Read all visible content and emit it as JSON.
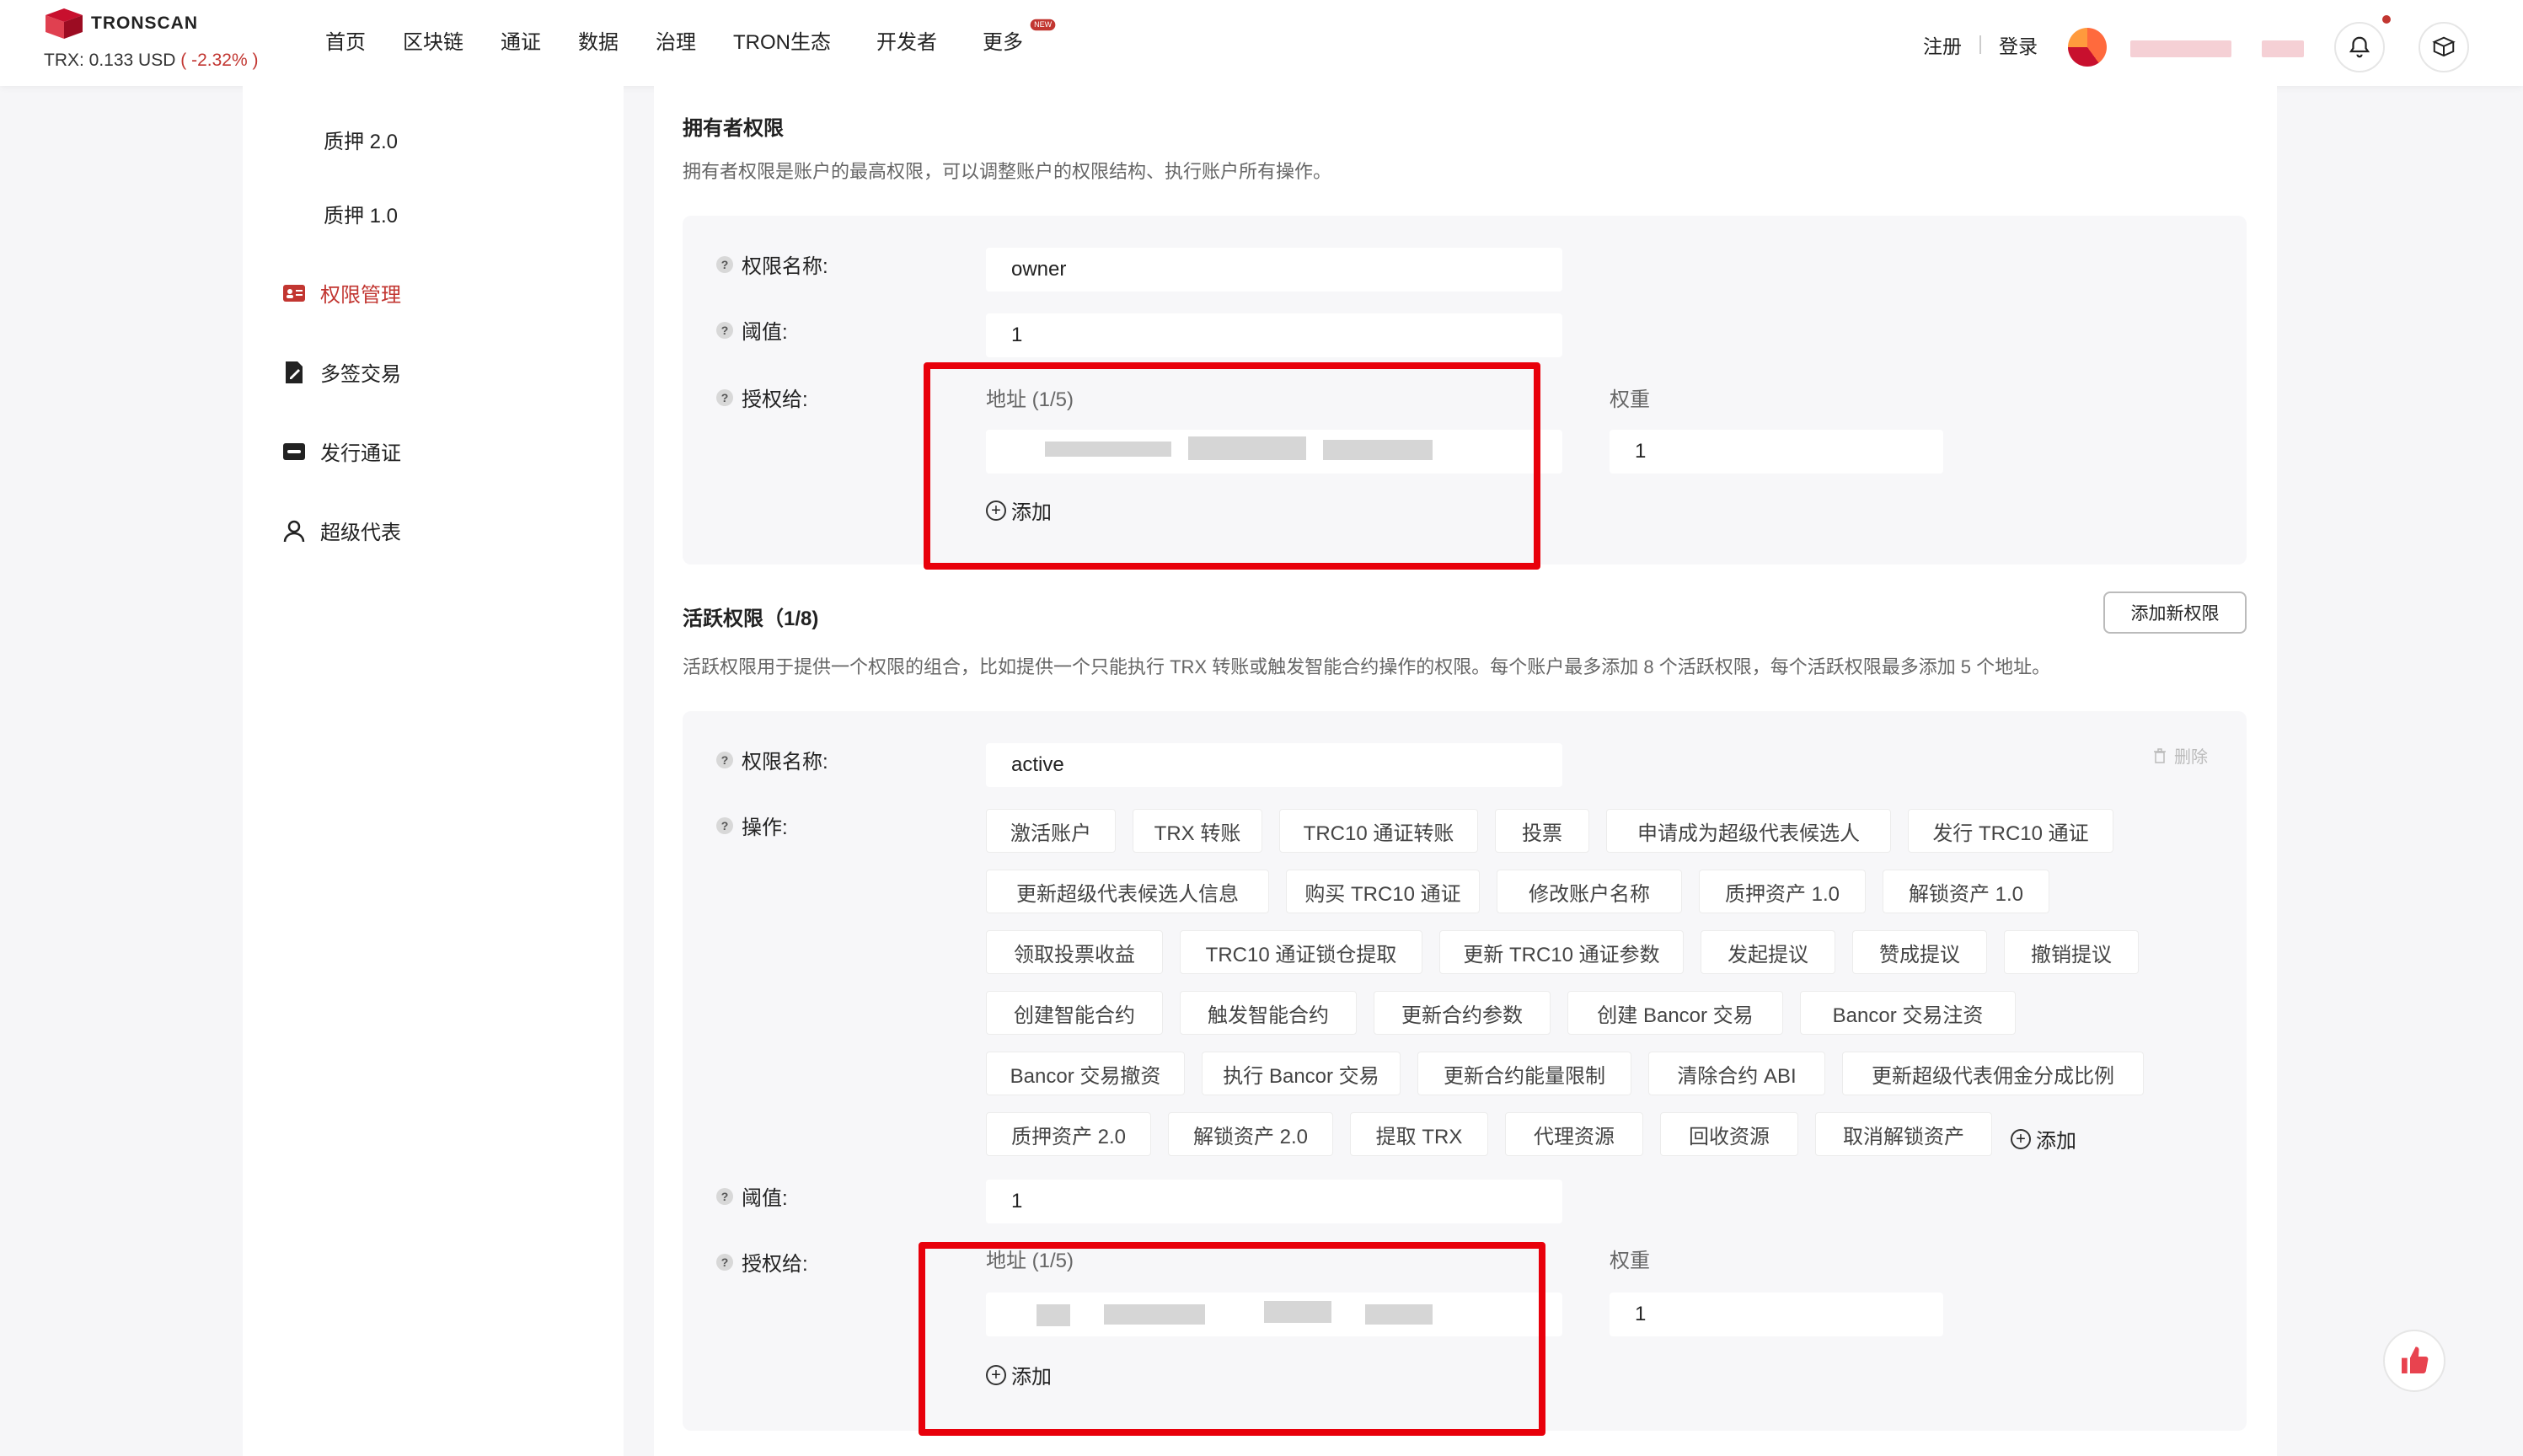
{
  "brand": {
    "name": "TRONSCAN",
    "price_label": "TRX: 0.133 USD",
    "price_change": "( -2.32% )"
  },
  "nav": [
    "首页",
    "区块链",
    "通证",
    "数据",
    "治理",
    "TRON生态",
    "开发者",
    "更多"
  ],
  "nav_badge": "NEW",
  "header_actions": {
    "register": "注册",
    "login": "登录"
  },
  "sidebar": {
    "items": [
      {
        "label": "质押 2.0",
        "icon": "none"
      },
      {
        "label": "质押 1.0",
        "icon": "none"
      },
      {
        "label": "权限管理",
        "icon": "id-card-icon"
      },
      {
        "label": "多签交易",
        "icon": "document-sign-icon"
      },
      {
        "label": "发行通证",
        "icon": "token-icon"
      },
      {
        "label": "超级代表",
        "icon": "user-icon"
      }
    ]
  },
  "owner": {
    "title": "拥有者权限",
    "desc": "拥有者权限是账户的最高权限，可以调整账户的权限结构、执行账户所有操作。",
    "name_label": "权限名称:",
    "name_value": "owner",
    "threshold_label": "阈值:",
    "threshold_value": "1",
    "auth_label": "授权给:",
    "address_head": "地址 (1/5)",
    "weight_head": "权重",
    "weight_value": "1",
    "add_label": "添加"
  },
  "active": {
    "title": "活跃权限（1/8)",
    "add_perm_button": "添加新权限",
    "desc": "活跃权限用于提供一个权限的组合，比如提供一个只能执行 TRX 转账或触发智能合约操作的权限。每个账户最多添加 8 个活跃权限，每个活跃权限最多添加 5 个地址。",
    "name_label": "权限名称:",
    "name_value": "active",
    "delete_label": "删除",
    "ops_label": "操作:",
    "ops": [
      [
        "激活账户",
        "TRX 转账",
        "TRC10 通证转账",
        "投票",
        "申请成为超级代表候选人",
        "发行 TRC10 通证"
      ],
      [
        "更新超级代表候选人信息",
        "购买 TRC10 通证",
        "修改账户名称",
        "质押资产 1.0",
        "解锁资产 1.0"
      ],
      [
        "领取投票收益",
        "TRC10 通证锁仓提取",
        "更新 TRC10 通证参数",
        "发起提议",
        "赞成提议",
        "撤销提议"
      ],
      [
        "创建智能合约",
        "触发智能合约",
        "更新合约参数",
        "创建 Bancor 交易",
        "Bancor 交易注资"
      ],
      [
        "Bancor 交易撤资",
        "执行 Bancor 交易",
        "更新合约能量限制",
        "清除合约 ABI",
        "更新超级代表佣金分成比例"
      ],
      [
        "质押资产 2.0",
        "解锁资产 2.0",
        "提取 TRX",
        "代理资源",
        "回收资源",
        "取消解锁资产"
      ]
    ],
    "ops_add_label": "添加",
    "threshold_label": "阈值:",
    "threshold_value": "1",
    "auth_label": "授权给:",
    "address_head": "地址 (1/5)",
    "weight_head": "权重",
    "weight_value": "1",
    "add_label": "添加"
  }
}
